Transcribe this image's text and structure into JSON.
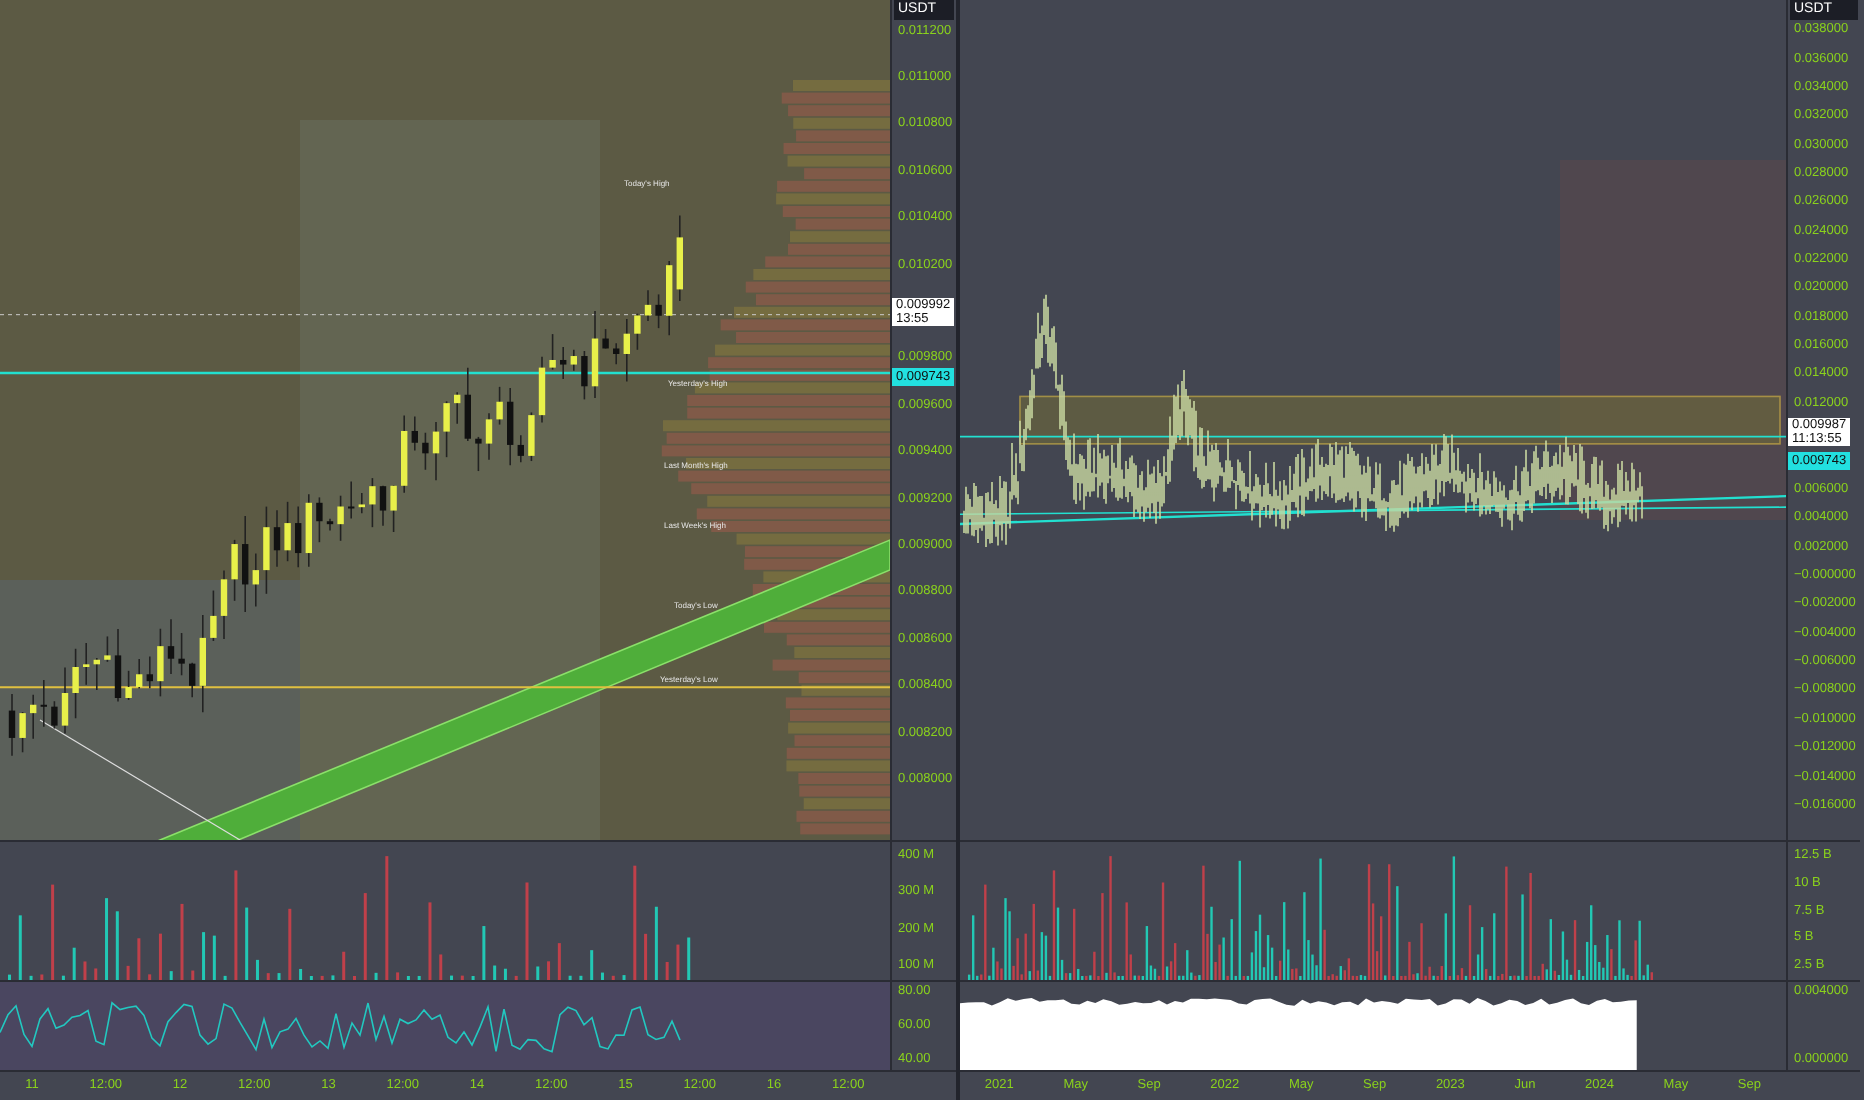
{
  "panels": [
    {
      "kind": "intraday",
      "axis_unit": "USDT",
      "price_scale": [
        {
          "kind": "tick",
          "label": "0.011200"
        },
        {
          "kind": "tick",
          "label": "0.011000"
        },
        {
          "kind": "tick",
          "label": "0.010800"
        },
        {
          "kind": "tick",
          "label": "0.010600"
        },
        {
          "kind": "tick",
          "label": "0.010400"
        },
        {
          "kind": "tick",
          "label": "0.010200"
        },
        {
          "kind": "last",
          "value": "0.009992",
          "time": "13:55"
        },
        {
          "kind": "tick",
          "label": "0.009800"
        },
        {
          "kind": "level",
          "value": "0.009743"
        },
        {
          "kind": "tick",
          "label": "0.009600"
        },
        {
          "kind": "tick",
          "label": "0.009400"
        },
        {
          "kind": "tick",
          "label": "0.009200"
        },
        {
          "kind": "tick",
          "label": "0.009000"
        },
        {
          "kind": "tick",
          "label": "0.008800"
        },
        {
          "kind": "tick",
          "label": "0.008600"
        },
        {
          "kind": "tick",
          "label": "0.008400"
        },
        {
          "kind": "tick",
          "label": "0.008200"
        },
        {
          "kind": "tick",
          "label": "0.008000"
        }
      ],
      "annotations": [
        "Today's High",
        "Yesterday's High",
        "Last Month's High",
        "Last Week's High",
        "Today's Low",
        "Yesterday's Low"
      ],
      "volume_ticks": [
        "400 M",
        "300 M",
        "200 M",
        "100 M"
      ],
      "lower_ticks": [
        "80.00",
        "60.00",
        "40.00"
      ],
      "time_ticks": [
        "11",
        "12:00",
        "12",
        "12:00",
        "13",
        "12:00",
        "14",
        "12:00",
        "15",
        "12:00",
        "16",
        "12:00"
      ]
    },
    {
      "kind": "daily",
      "axis_unit": "USDT",
      "price_scale": [
        {
          "kind": "tick",
          "label": "0.038000"
        },
        {
          "kind": "tick",
          "label": "0.036000"
        },
        {
          "kind": "tick",
          "label": "0.034000"
        },
        {
          "kind": "tick",
          "label": "0.032000"
        },
        {
          "kind": "tick",
          "label": "0.030000"
        },
        {
          "kind": "tick",
          "label": "0.028000"
        },
        {
          "kind": "tick",
          "label": "0.026000"
        },
        {
          "kind": "tick",
          "label": "0.024000"
        },
        {
          "kind": "tick",
          "label": "0.022000"
        },
        {
          "kind": "tick",
          "label": "0.020000"
        },
        {
          "kind": "tick",
          "label": "0.018000"
        },
        {
          "kind": "tick",
          "label": "0.016000"
        },
        {
          "kind": "tick",
          "label": "0.014000"
        },
        {
          "kind": "tick",
          "label": "0.012000"
        },
        {
          "kind": "last",
          "value": "0.009987",
          "time": "11:13:55"
        },
        {
          "kind": "level",
          "value": "0.009743"
        },
        {
          "kind": "tick",
          "label": "0.006000"
        },
        {
          "kind": "tick",
          "label": "0.004000"
        },
        {
          "kind": "tick",
          "label": "0.002000"
        },
        {
          "kind": "tick",
          "label": "−0.000000"
        },
        {
          "kind": "tick",
          "label": "−0.002000"
        },
        {
          "kind": "tick",
          "label": "−0.004000"
        },
        {
          "kind": "tick",
          "label": "−0.006000"
        },
        {
          "kind": "tick",
          "label": "−0.008000"
        },
        {
          "kind": "tick",
          "label": "−0.010000"
        },
        {
          "kind": "tick",
          "label": "−0.012000"
        },
        {
          "kind": "tick",
          "label": "−0.014000"
        },
        {
          "kind": "tick",
          "label": "−0.016000"
        }
      ],
      "volume_ticks": [
        "12.5 B",
        "10 B",
        "7.5 B",
        "5 B",
        "2.5 B"
      ],
      "lower_ticks": [
        "0.004000",
        "0.000000"
      ],
      "time_ticks": [
        "2021",
        "May",
        "Sep",
        "2022",
        "May",
        "Sep",
        "2023",
        "Jun",
        "2024",
        "May",
        "Sep"
      ]
    }
  ]
}
